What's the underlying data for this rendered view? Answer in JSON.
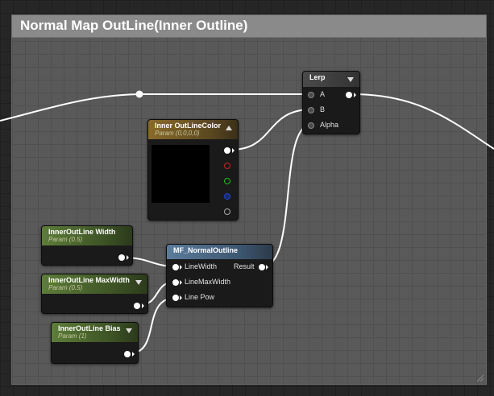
{
  "comment": {
    "title": "Normal Map OutLine(Inner Outline)"
  },
  "nodes": {
    "lerp": {
      "title": "Lerp",
      "inputs": [
        "A",
        "B",
        "Alpha"
      ]
    },
    "inner_outline_color": {
      "title": "Inner OutLineColor",
      "subtitle": "Param (0,0,0,0)",
      "preview_color": "#000000",
      "channel_colors": [
        "#ffffff",
        "#cc2222",
        "#22bb22",
        "#2244cc",
        "#aaaaaa"
      ]
    },
    "inner_outline_width": {
      "title": "InnerOutLine Width",
      "subtitle": "Param (0.5)"
    },
    "inner_outline_maxwidth": {
      "title": "InnerOutLine MaxWidth",
      "subtitle": "Param (0.5)"
    },
    "inner_outline_bias": {
      "title": "InnerOutLine Bias",
      "subtitle": "Param (1)"
    },
    "mf_normal_outline": {
      "title": "MF_NormalOutline",
      "inputs": [
        "LineWidth",
        "LineMaxWidth",
        "Line Pow"
      ],
      "output": "Result"
    }
  }
}
